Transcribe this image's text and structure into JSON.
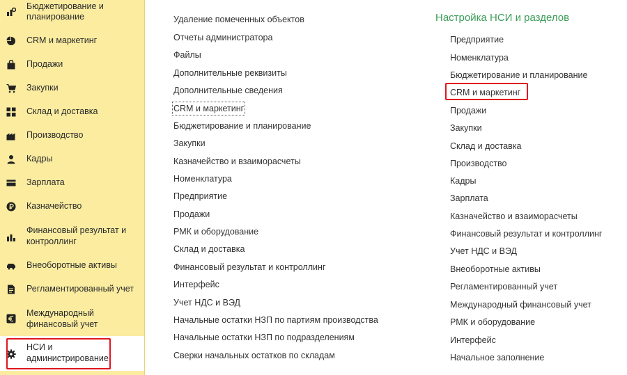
{
  "sidebar": {
    "items": [
      {
        "label_line1": "Бюджетирование и",
        "label_line2": "планирование",
        "icon": "budget-icon"
      },
      {
        "label": "CRM и маркетинг",
        "icon": "pie-chart-icon"
      },
      {
        "label": "Продажи",
        "icon": "shopping-bag-icon"
      },
      {
        "label": "Закупки",
        "icon": "cart-icon"
      },
      {
        "label": "Склад и доставка",
        "icon": "warehouse-grid-icon"
      },
      {
        "label": "Производство",
        "icon": "factory-icon"
      },
      {
        "label": "Кадры",
        "icon": "person-icon"
      },
      {
        "label": "Зарплата",
        "icon": "card-icon"
      },
      {
        "label": "Казначейство",
        "icon": "ruble-coin-icon"
      },
      {
        "label_line1": "Финансовый результат и",
        "label_line2": "контроллинг",
        "icon": "bar-chart-icon"
      },
      {
        "label": "Внеоборотные активы",
        "icon": "car-icon"
      },
      {
        "label": "Регламентированный учет",
        "icon": "document-icon"
      },
      {
        "label_line1": "Международный",
        "label_line2": "финансовый учет",
        "icon": "euro-icon"
      },
      {
        "label_line1": "НСИ и",
        "label_line2": "администрирование",
        "icon": "gear-icon"
      }
    ]
  },
  "middle": {
    "links": [
      "Удаление помеченных объектов",
      "Отчеты администратора",
      "Файлы",
      "Дополнительные реквизиты",
      "Дополнительные сведения",
      "CRM и маркетинг",
      "Бюджетирование и планирование",
      "Закупки",
      "Казначейство и взаиморасчеты",
      "Номенклатура",
      "Предприятие",
      "Продажи",
      "РМК и оборудование",
      "Склад и доставка",
      "Финансовый результат и контроллинг",
      "Интерфейс",
      "Учет НДС и ВЭД",
      "Начальные остатки НЗП по партиям производства",
      "Начальные остатки НЗП по подразделениям",
      "Сверки начальных остатков по складам"
    ]
  },
  "right": {
    "title": "Настройка НСИ и разделов",
    "links": [
      "Предприятие",
      "Номенклатура",
      "Бюджетирование и планирование",
      "CRM и маркетинг",
      "Продажи",
      "Закупки",
      "Склад и доставка",
      "Производство",
      "Кадры",
      "Зарплата",
      "Казначейство и взаиморасчеты",
      "Финансовый результат и контроллинг",
      "Учет НДС и ВЭД",
      "Внеоборотные активы",
      "Регламентированный учет",
      "Международный финансовый учет",
      "РМК и оборудование",
      "Интерфейс",
      "Начальное заполнение"
    ]
  },
  "colors": {
    "sidebar_bg": "#fbeca0",
    "section_title": "#3c9c58",
    "highlight": "#e0161d"
  }
}
